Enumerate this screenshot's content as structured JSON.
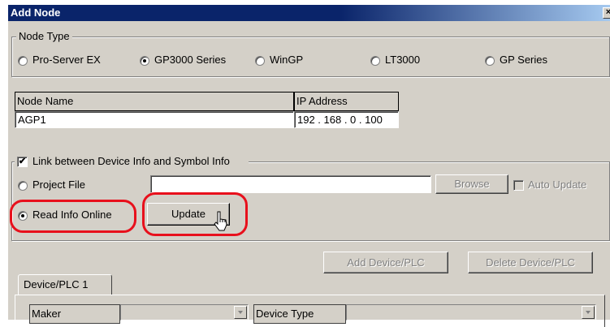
{
  "window": {
    "title": "Add Node",
    "close_glyph": "×"
  },
  "node_type": {
    "legend": "Node Type",
    "options": [
      {
        "label": "Pro-Server EX",
        "selected": false
      },
      {
        "label": "GP3000 Series",
        "selected": true
      },
      {
        "label": "WinGP",
        "selected": false
      },
      {
        "label": "LT3000",
        "selected": false
      },
      {
        "label": "GP Series",
        "selected": false
      }
    ]
  },
  "node": {
    "name_header": "Node Name",
    "ip_header": "IP Address",
    "name_value": "AGP1",
    "ip_value": "192 . 168 .   0  . 100"
  },
  "link": {
    "label": "Link between Device Info and Symbol Info",
    "checked": true,
    "project_file_label": "Project File",
    "project_file_value": "",
    "browse_label": "Browse",
    "auto_update_label": "Auto Update",
    "read_online_label": "Read Info Online",
    "update_label": "Update",
    "check_glyph": "✔"
  },
  "device": {
    "add_label": "Add Device/PLC",
    "delete_label": "Delete Device/PLC",
    "tab_label": "Device/PLC 1",
    "maker_label": "Maker",
    "device_type_label": "Device Type"
  },
  "colors": {
    "highlight": "#e8101c",
    "title_bar": "#0a246a"
  }
}
